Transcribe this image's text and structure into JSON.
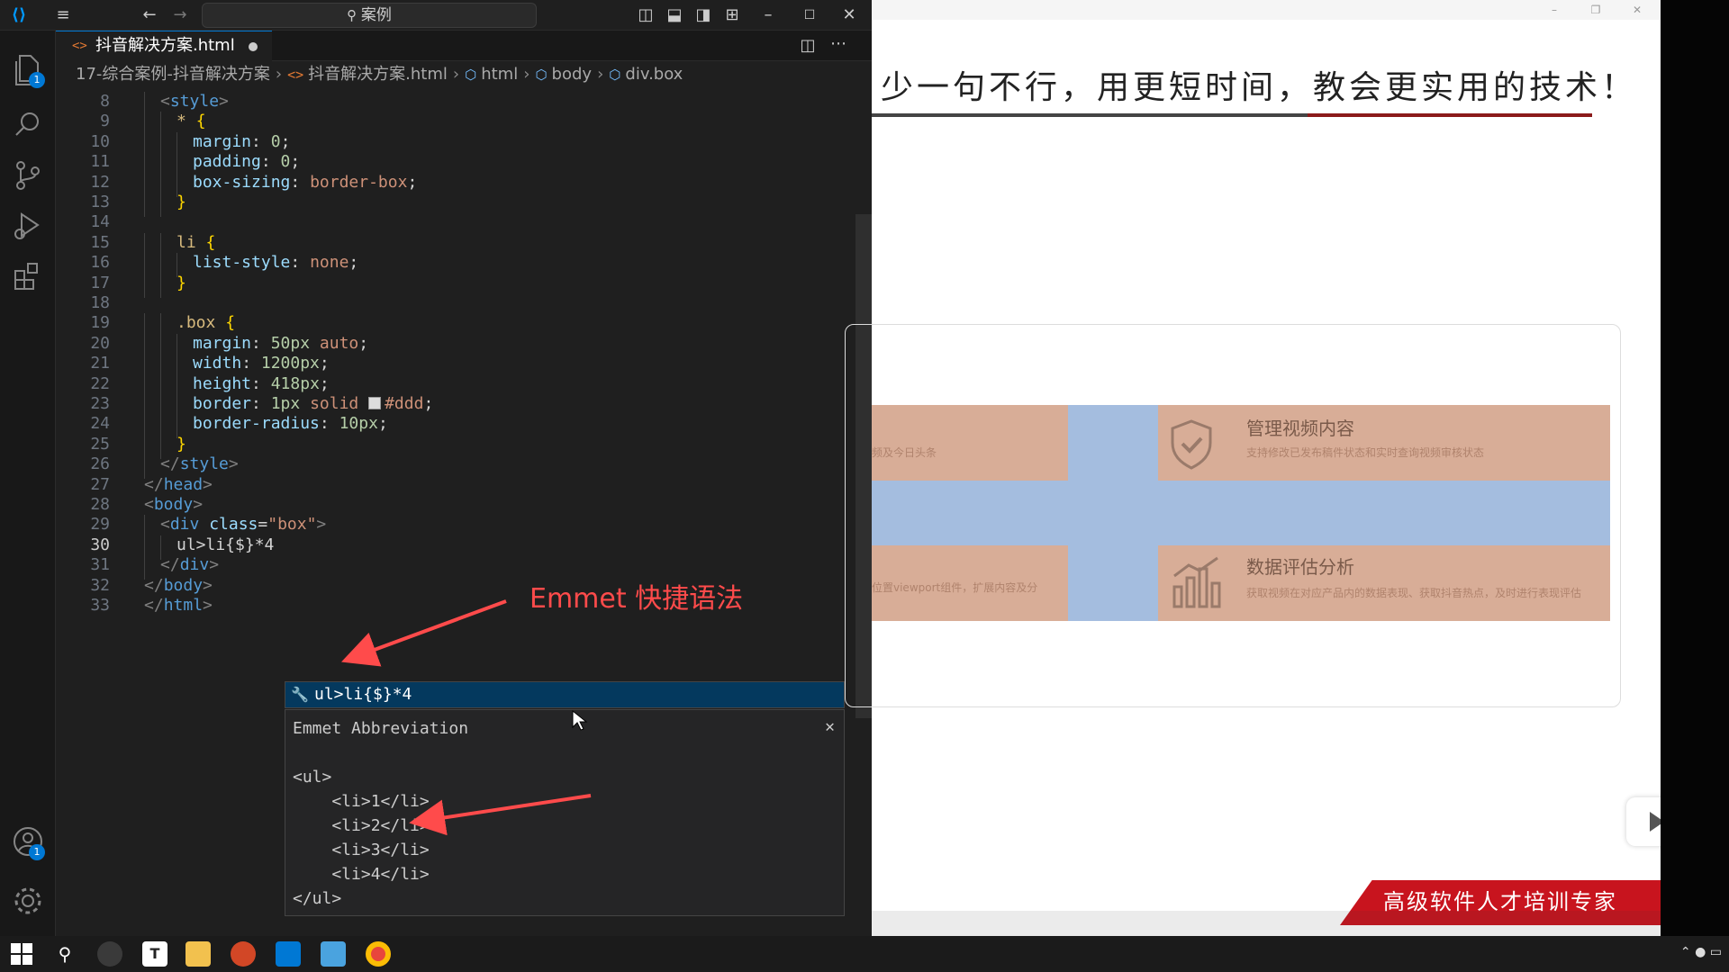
{
  "vscode": {
    "search_text": "案例",
    "tab": {
      "filename": "抖音解决方案.html"
    },
    "breadcrumb": [
      "17-综合案例-抖音解决方案",
      "抖音解决方案.html",
      "html",
      "body",
      "div.box"
    ],
    "badges": {
      "explorer": "1",
      "accounts": "1"
    },
    "lines": [
      {
        "n": "8",
        "text": "<style>"
      },
      {
        "n": "9",
        "text": "* {"
      },
      {
        "n": "10",
        "text": "margin: 0;"
      },
      {
        "n": "11",
        "text": "padding: 0;"
      },
      {
        "n": "12",
        "text": "box-sizing: border-box;"
      },
      {
        "n": "13",
        "text": "}"
      },
      {
        "n": "14",
        "text": ""
      },
      {
        "n": "15",
        "text": "li {"
      },
      {
        "n": "16",
        "text": "list-style: none;"
      },
      {
        "n": "17",
        "text": "}"
      },
      {
        "n": "18",
        "text": ""
      },
      {
        "n": "19",
        "text": ".box {"
      },
      {
        "n": "20",
        "text": "margin: 50px auto;"
      },
      {
        "n": "21",
        "text": "width: 1200px;"
      },
      {
        "n": "22",
        "text": "height: 418px;"
      },
      {
        "n": "23",
        "text": "border: 1px solid #ddd;"
      },
      {
        "n": "24",
        "text": "border-radius: 10px;"
      },
      {
        "n": "25",
        "text": "}"
      },
      {
        "n": "26",
        "text": "</style>"
      },
      {
        "n": "27",
        "text": "</head>"
      },
      {
        "n": "28",
        "text": "<body>"
      },
      {
        "n": "29",
        "text": "<div class=\"box\">"
      },
      {
        "n": "30",
        "text": "ul>li{$}*4"
      },
      {
        "n": "31",
        "text": "</div>"
      },
      {
        "n": "32",
        "text": "</body>"
      },
      {
        "n": "33",
        "text": "</html>"
      }
    ],
    "suggestion": "ul>li{$}*4",
    "detail": {
      "title": "Emmet Abbreviation",
      "lines": [
        "<ul>",
        "    <li>1</li>",
        "    <li>2</li>",
        "    <li>3</li>",
        "    <li>4</li>",
        "</ul>"
      ]
    },
    "annotation": "Emmet 快捷语法"
  },
  "browser": {
    "slogan": "少一句不行，用更短时间，教会更实用的技术！",
    "cards": [
      {
        "title": "管理视频内容",
        "desc": "支持修改已发布稿件状态和实时查询视频审核状态"
      },
      {
        "title": "数据评估分析",
        "desc": "获取视频在对应产品内的数据表现、获取抖音热点，及时进行表现评估"
      }
    ],
    "left_fragments": [
      "频及今日头条",
      "位置viewport组件，扩展内容及分"
    ],
    "promo": "高级软件人才培训专家"
  },
  "colors": {
    "accent": "#0078d4",
    "annotation": "#ff4b4b",
    "card": "#d8ad97",
    "band": "#a4bddf",
    "promo": "#c8141e"
  }
}
